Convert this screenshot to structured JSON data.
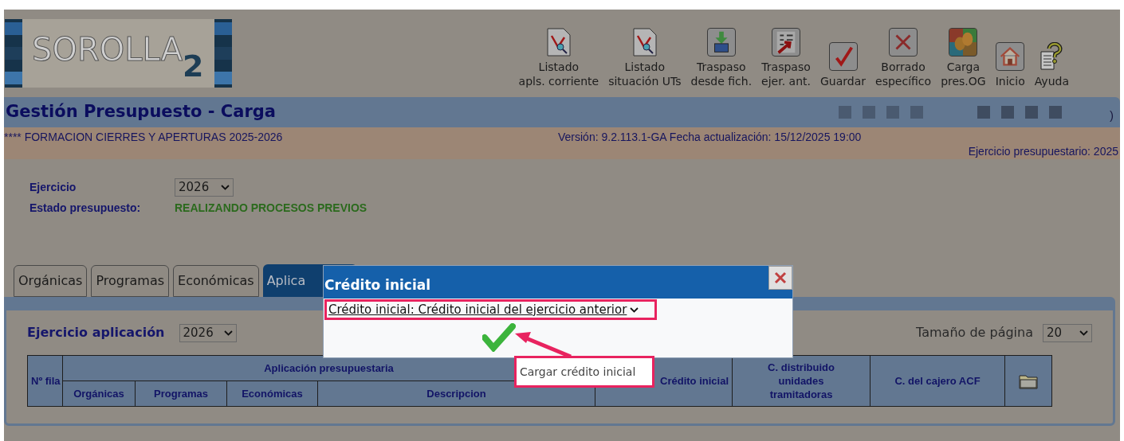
{
  "logo": {
    "text": "SOROLLA",
    "sub": "2"
  },
  "toolbar": [
    {
      "kind": "report",
      "lines": [
        "Listado",
        "apls. corriente"
      ]
    },
    {
      "kind": "report",
      "lines": [
        "Listado",
        "situación UTs"
      ]
    },
    {
      "kind": "import",
      "lines": [
        "Traspaso",
        "desde fich."
      ]
    },
    {
      "kind": "transfer",
      "lines": [
        "Traspaso",
        "ejer. ant."
      ]
    },
    {
      "kind": "save",
      "lines": [
        "Guardar"
      ]
    },
    {
      "kind": "delete",
      "lines": [
        "Borrado",
        "específico"
      ]
    },
    {
      "kind": "load",
      "lines": [
        "Carga",
        "pres.OG"
      ]
    },
    {
      "kind": "home",
      "lines": [
        "Inicio"
      ]
    },
    {
      "kind": "help",
      "lines": [
        "Ayuda"
      ]
    }
  ],
  "title_bar": {
    "title": "Gestión Presupuesto - Carga",
    "trailing": ")"
  },
  "info_bar": {
    "course": "**** FORMACION CIERRES Y APERTURAS 2025-2026",
    "version": "Versión: 9.2.113.1-GA Fecha actualización: 15/12/2025 19:00",
    "fiscal_year": "Ejercicio presupuestario: 2025"
  },
  "form": {
    "year_label": "Ejercicio",
    "year_value": "2026",
    "status_label": "Estado presupuesto:",
    "status_value": "REALIZANDO PROCESOS PREVIOS"
  },
  "tabs": [
    {
      "label": "Orgánicas",
      "selected": false
    },
    {
      "label": "Programas",
      "selected": false
    },
    {
      "label": "Económicas",
      "selected": false
    },
    {
      "label": "Aplica",
      "selected": true
    }
  ],
  "panel": {
    "year_label": "Ejercicio aplicación",
    "year_value": "2026",
    "page_size_label": "Tamaño de página",
    "page_size_value": "20"
  },
  "table": {
    "row_number": "Nº fila",
    "group": "Aplicación presupuestaria",
    "sub_columns": [
      "Orgánicas",
      "Programas",
      "Económicas",
      "Descripcion"
    ],
    "columns": [
      "Crédito inicial",
      "C. distribuido unidades tramitadoras",
      "C. del cajero ACF"
    ]
  },
  "dialog": {
    "title": "Crédito inicial",
    "select_value": "Crédito inicial: Crédito inicial del ejercicio anterior"
  },
  "tooltip": {
    "text": "Cargar crédito inicial"
  }
}
